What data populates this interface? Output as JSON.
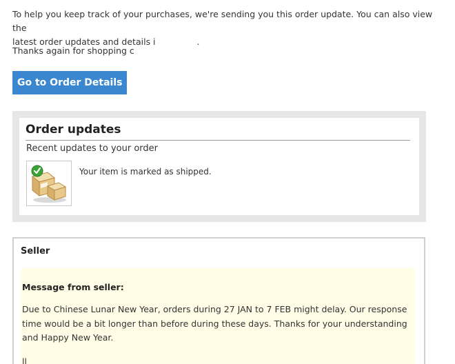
{
  "intro": {
    "line1": "To help you keep track of your purchases, we're sending you this order update. You can also view the",
    "line2": "latest order updates and details i",
    "line2_end": "."
  },
  "thanks": "Thanks again for shopping c",
  "cta_label": "Go to Order Details",
  "updates": {
    "title": "Order updates",
    "subtitle": "Recent updates to your order",
    "status_text": "Your item is marked as shipped.",
    "icon": "shipped-boxes-icon",
    "check_color": "#3aa335"
  },
  "seller": {
    "title": "Seller",
    "message_label": "Message from seller:",
    "message_body": "Due to Chinese Lunar New Year, orders during 27 JAN to 7 FEB might delay. Our response time would be a bit longer than before during these days. Thanks for your understanding and Happy New Year.",
    "message_tail": "ll"
  },
  "colors": {
    "button": "#3a87d0",
    "panel_bg": "#e6e6e6",
    "message_bg": "#fffde6"
  }
}
